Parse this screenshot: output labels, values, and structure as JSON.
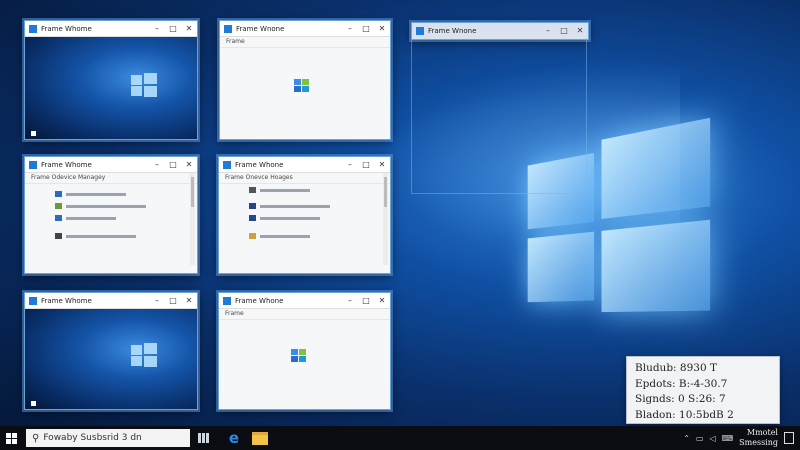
{
  "desktop": {
    "accent": "#0f4fa3"
  },
  "windows": [
    {
      "title": "Frame Whome",
      "menu": ""
    },
    {
      "title": "Frame Wnone",
      "menu": "Frame"
    },
    {
      "title": "Frame Wnone",
      "menu": ""
    },
    {
      "title": "Frame Whome",
      "menu": "Frame Odevice Managey"
    },
    {
      "title": "Frame Whone",
      "menu": "Frame Onevce Hoages"
    },
    {
      "title": "Frame Whome",
      "menu": ""
    },
    {
      "title": "Frame Whone",
      "menu": "Frame"
    }
  ],
  "controls": {
    "minimize": "–",
    "maximize": "□",
    "close": "✕"
  },
  "info_panel": {
    "lines": [
      "Bludub: 8930 T",
      "Epdots: B:-4-30.7",
      "Signds: 0 S:26: 7",
      "Bladon: 10:5bdB 2"
    ]
  },
  "taskbar": {
    "search_text": "Fowaby Susbsrid 3 dn",
    "icons": [
      "start-icon",
      "search-icon",
      "task-view-icon",
      "edge-icon",
      "file-explorer-icon"
    ],
    "tray_icons": [
      "chevron-up-icon",
      "network-icon",
      "volume-icon",
      "keyboard-icon"
    ],
    "clock_line1": "Mmotel",
    "clock_line2": "Smessing"
  }
}
